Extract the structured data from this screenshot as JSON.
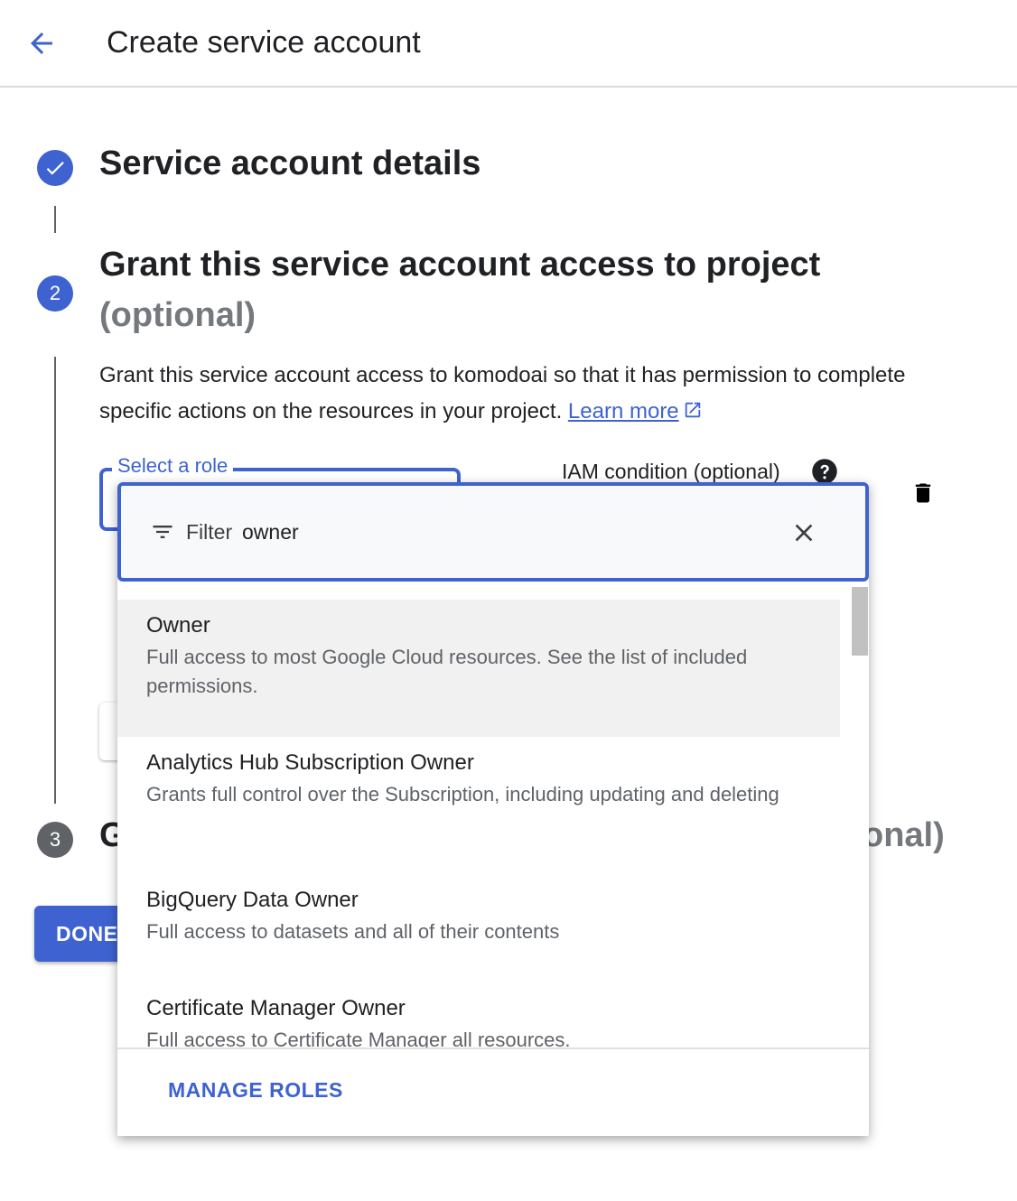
{
  "header": {
    "title": "Create service account",
    "back_icon": "arrow-back-icon"
  },
  "steps": [
    {
      "number": "",
      "status": "completed",
      "icon": "check-icon",
      "title": "Service account details"
    },
    {
      "number": "2",
      "status": "active",
      "title": "Grant this service account access to project",
      "title_suffix": "(optional)"
    },
    {
      "number": "3",
      "status": "pending",
      "title_start": "G",
      "title_end": "onal)"
    }
  ],
  "step2": {
    "description": "Grant this service account access to komodoai so that it has permission to complete specific actions on the resources in your project.",
    "learn_more": "Learn more",
    "role_label": "Select a role",
    "iam_condition_label": "IAM condition (optional)"
  },
  "done_button": "DONE",
  "dropdown": {
    "filter_label": "Filter",
    "filter_value": "owner",
    "options": [
      {
        "title": "Owner",
        "description": "Full access to most Google Cloud resources. See the list of included permissions."
      },
      {
        "title": "Analytics Hub Subscription Owner",
        "description": "Grants full control over the Subscription, including updating and deleting"
      },
      {
        "title": "BigQuery Data Owner",
        "description": "Full access to datasets and all of their contents"
      },
      {
        "title": "Certificate Manager Owner",
        "description": "Full access to Certificate Manager all resources."
      }
    ],
    "manage_roles": "MANAGE ROLES"
  },
  "colors": {
    "accent": "#3e63d0",
    "text": "#202124",
    "muted": "#5f6368",
    "optional": "#75787c"
  }
}
